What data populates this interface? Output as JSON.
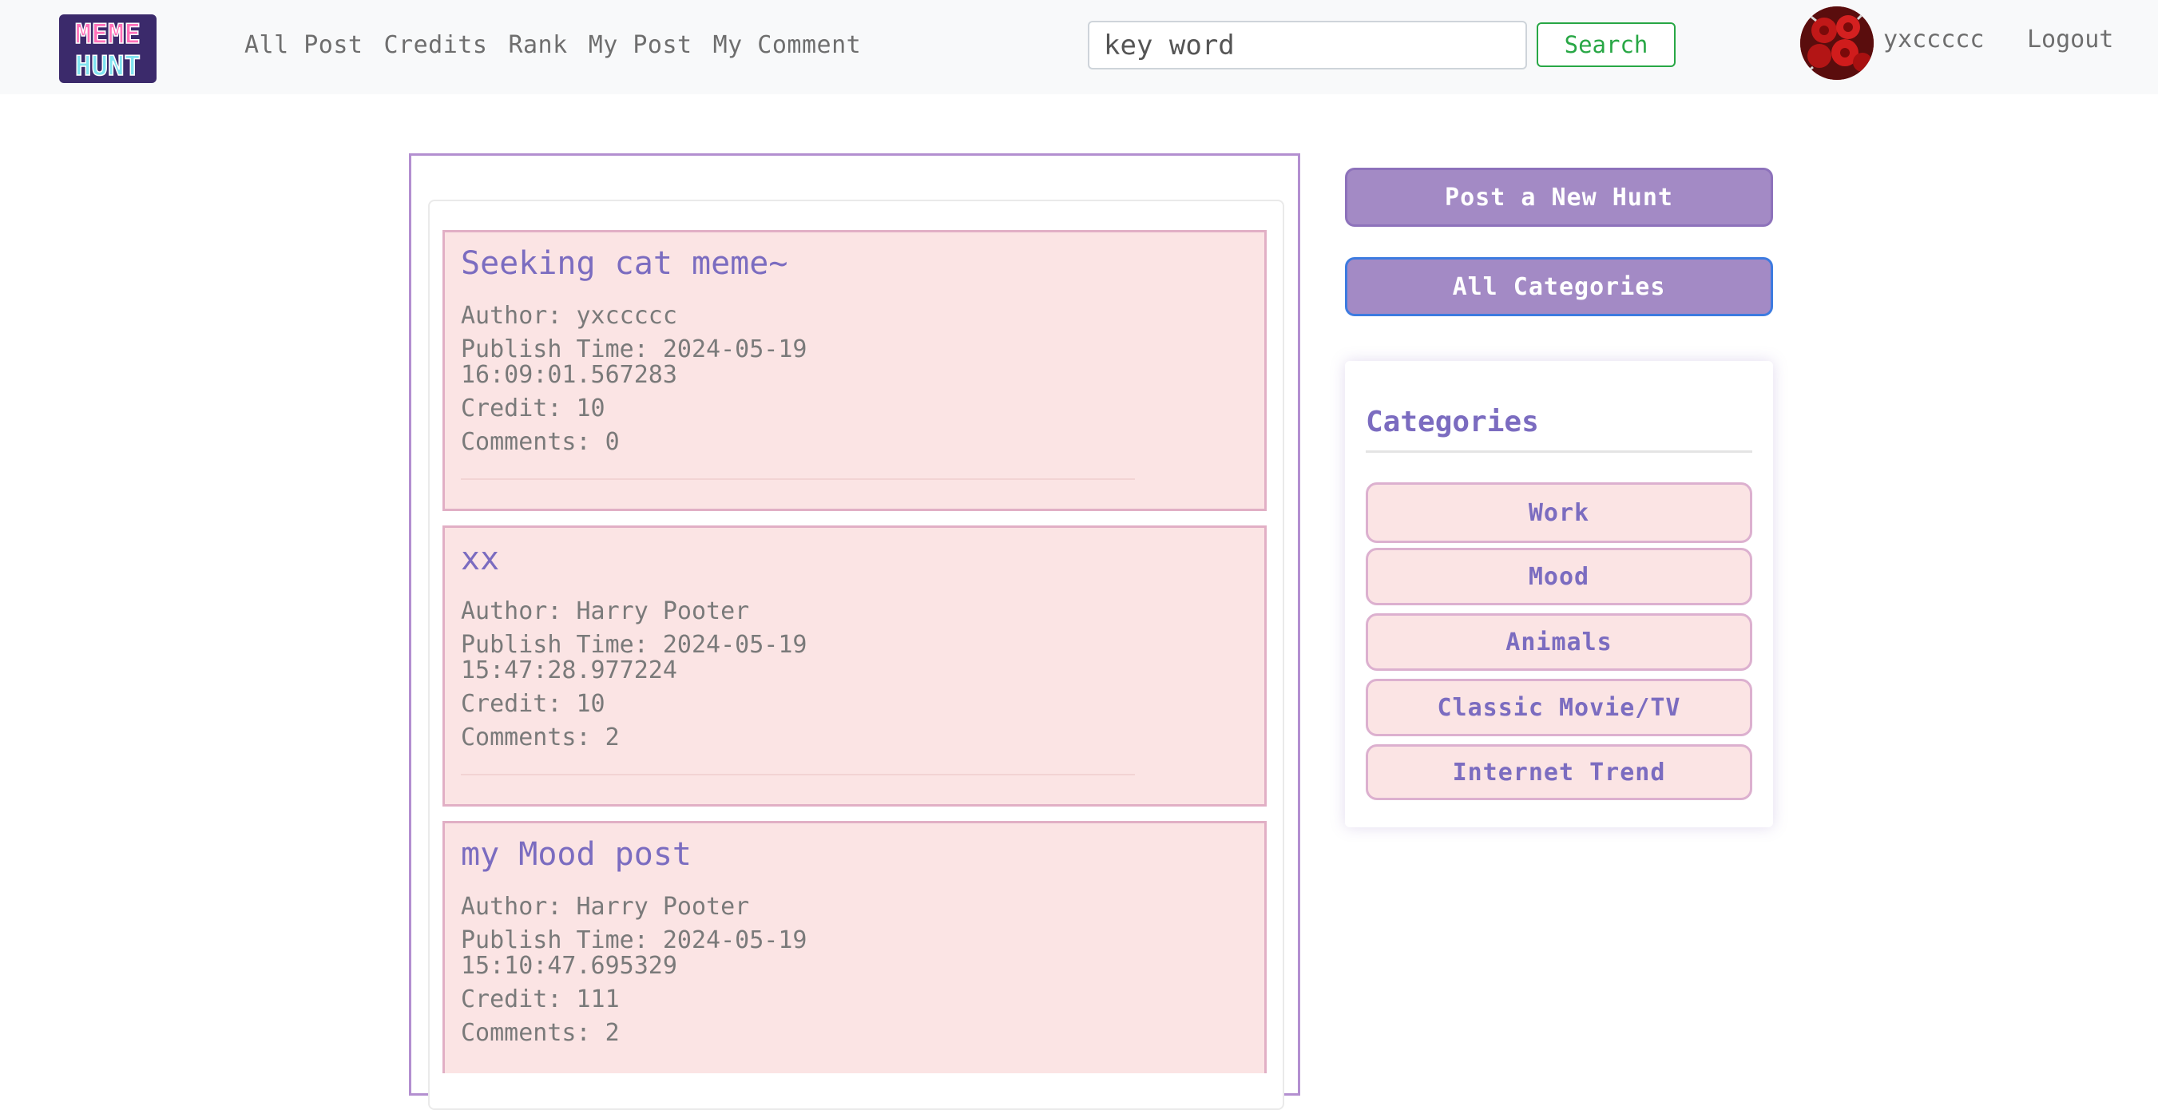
{
  "brand": {
    "logo_lines": [
      "MEME",
      "HUNT"
    ]
  },
  "nav": {
    "links": [
      "All Post",
      "Credits",
      "Rank",
      "My Post",
      "My Comment"
    ]
  },
  "search": {
    "placeholder": "key word",
    "button_label": "Search"
  },
  "user": {
    "name": "yxccccc",
    "logout_label": "Logout"
  },
  "posts": [
    {
      "title": "Seeking cat meme~",
      "author": "Author: yxccccc",
      "publish_line1": "Publish Time: 2024-05-19",
      "publish_line2": "16:09:01.567283",
      "credit": "Credit: 10",
      "comments": "Comments: 0"
    },
    {
      "title": "xx",
      "author": "Author: Harry Pooter",
      "publish_line1": "Publish Time: 2024-05-19",
      "publish_line2": "15:47:28.977224",
      "credit": "Credit: 10",
      "comments": "Comments: 2"
    },
    {
      "title": "my Mood post",
      "author": "Author: Harry Pooter",
      "publish_line1": "Publish Time: 2024-05-19",
      "publish_line2": "15:10:47.695329",
      "credit": "Credit: 111",
      "comments": "Comments: 2"
    }
  ],
  "sidebar": {
    "new_hunt_label": "Post a New Hunt",
    "all_categories_label": "All Categories",
    "categories_heading": "Categories",
    "categories": [
      "Work",
      "Mood",
      "Animals",
      "Classic Movie/TV",
      "Internet Trend"
    ]
  },
  "colors": {
    "accent_purple": "#a38ac5",
    "title_purple": "#7b6cc0",
    "card_pink": "#fbe4e4",
    "search_green": "#28a745"
  }
}
